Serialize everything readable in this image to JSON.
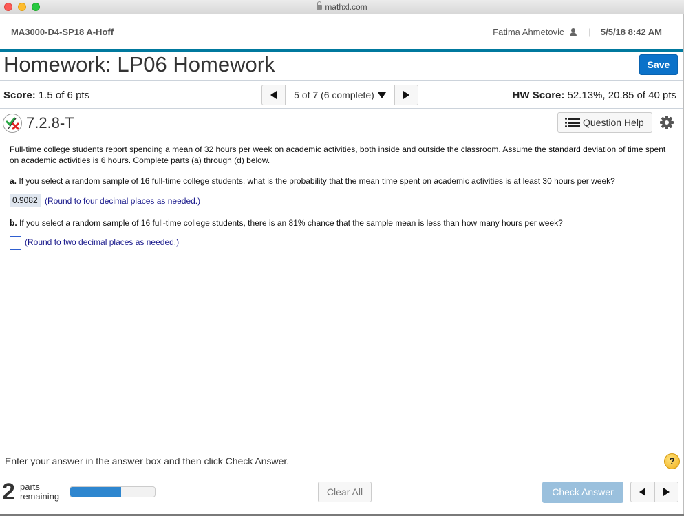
{
  "browser": {
    "url": "mathxl.com"
  },
  "header": {
    "course": "MA3000-D4-SP18 A-Hoff",
    "user_name": "Fatima Ahmetovic",
    "separator": "|",
    "datetime": "5/5/18 8:42 AM"
  },
  "title": {
    "text": "Homework: LP06 Homework",
    "save_label": "Save"
  },
  "score_row": {
    "score_label": "Score:",
    "score_value": "1.5 of 6 pts",
    "nav_text": "5 of 7 (6 complete)",
    "hw_score_label": "HW Score:",
    "hw_score_value": "52.13%, 20.85 of 40 pts"
  },
  "question": {
    "id": "7.2.8-T",
    "help_label": "Question Help",
    "intro": "Full-time college students report spending a mean of 32 hours per week on academic activities, both inside and outside the classroom. Assume the standard deviation of time spent on academic activities is 6 hours. Complete parts (a) through (d) below.",
    "parts": [
      {
        "label": "a.",
        "text": "If you select a random sample of 16 full-time college students, what is the probability that the mean time spent on academic activities is at least 30 hours per week?",
        "answer": "0.9082",
        "hint": "(Round to four decimal places as needed.)"
      },
      {
        "label": "b.",
        "text": "If you select a random sample of 16 full-time college students, there is an 81% chance that the sample mean is less than how many hours per week?",
        "answer": "",
        "hint": "(Round to two decimal places as needed.)"
      }
    ]
  },
  "footer": {
    "instruction": "Enter your answer in the answer box and then click Check Answer.",
    "help_glyph": "?",
    "parts_remaining_count": "2",
    "parts_word": "parts",
    "remaining_word": "remaining",
    "progress_fraction": 0.6,
    "clear_label": "Clear All",
    "check_label": "Check Answer"
  },
  "colors": {
    "accent_teal": "#00799e",
    "save_blue": "#0b72c9",
    "progress_blue": "#2e86cf",
    "check_disabled": "#9ac0dd",
    "hint_color": "#1a1a8c"
  }
}
